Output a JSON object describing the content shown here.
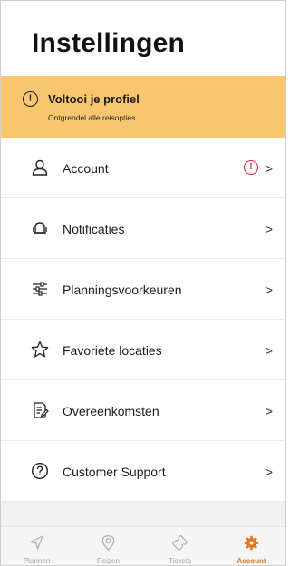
{
  "page": {
    "title": "Instellingen"
  },
  "banner": {
    "title": "Voltooi je profiel",
    "subtitle": "Ontgrendel alle reisopties",
    "icon": "warning-circle-icon",
    "color": "#f8c76d"
  },
  "settings": {
    "items": [
      {
        "label": "Account",
        "icon": "user-icon",
        "alert": "!"
      },
      {
        "label": "Notificaties",
        "icon": "bell-icon"
      },
      {
        "label": "Planningsvoorkeuren",
        "icon": "sliders-icon"
      },
      {
        "label": "Favoriete locaties",
        "icon": "star-icon"
      },
      {
        "label": "Overeenkomsten",
        "icon": "document-edit-icon"
      },
      {
        "label": "Customer Support",
        "icon": "help-circle-icon"
      }
    ],
    "chevron": ">"
  },
  "tabbar": {
    "tabs": [
      {
        "label": "Plannen",
        "icon": "navigate-icon"
      },
      {
        "label": "Reizen",
        "icon": "location-pin-icon"
      },
      {
        "label": "Tickets",
        "icon": "ticket-icon"
      },
      {
        "label": "Account",
        "icon": "gear-icon",
        "active": true
      }
    ],
    "active_color": "#e8761e",
    "inactive_color": "#a8a8a8"
  },
  "colors": {
    "alert": "#d8262c"
  }
}
